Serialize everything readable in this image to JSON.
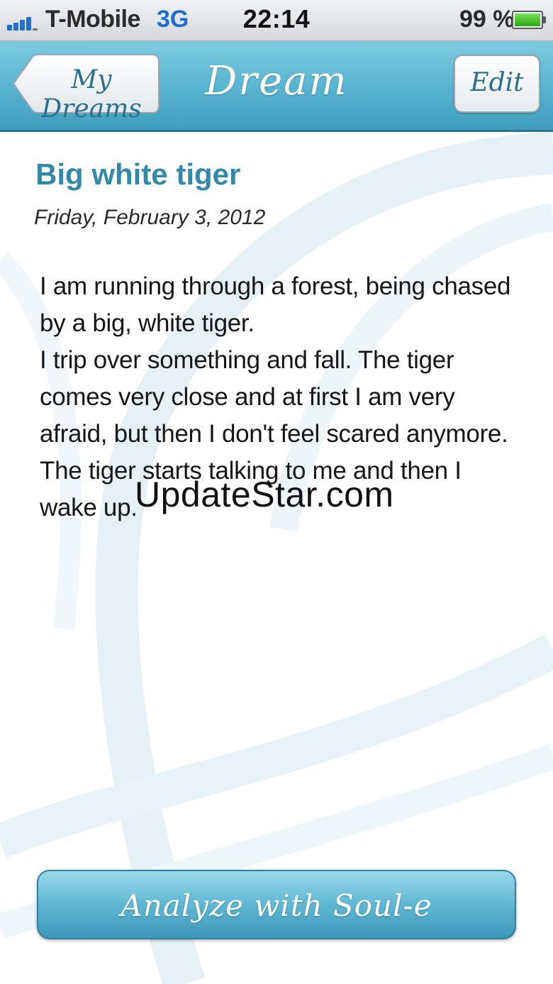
{
  "status_bar": {
    "carrier": "T-Mobile",
    "network": "3G",
    "time": "22:14",
    "battery_percent_label": "99 %",
    "battery_level": 0.99,
    "signal_icon": "signal-bars-icon",
    "battery_icon": "battery-icon"
  },
  "nav": {
    "back_label": "My Dreams",
    "title": "Dream",
    "edit_label": "Edit"
  },
  "dream": {
    "title": "Big white tiger",
    "date": "Friday, February 3, 2012",
    "text": "I am running through a forest, being chased by a big, white tiger.\nI trip over something and fall. The tiger comes very close and at first I am very afraid, but then I don't feel scared anymore. The tiger starts talking to me and then I wake up."
  },
  "watermark": "UpdateStar.com",
  "actions": {
    "analyze_label": "Analyze with Soul-e"
  },
  "colors": {
    "accent": "#3389a8",
    "nav_bar": "#56b3d0",
    "network": "#1f6fcf",
    "battery_fill": "#2ea613"
  }
}
